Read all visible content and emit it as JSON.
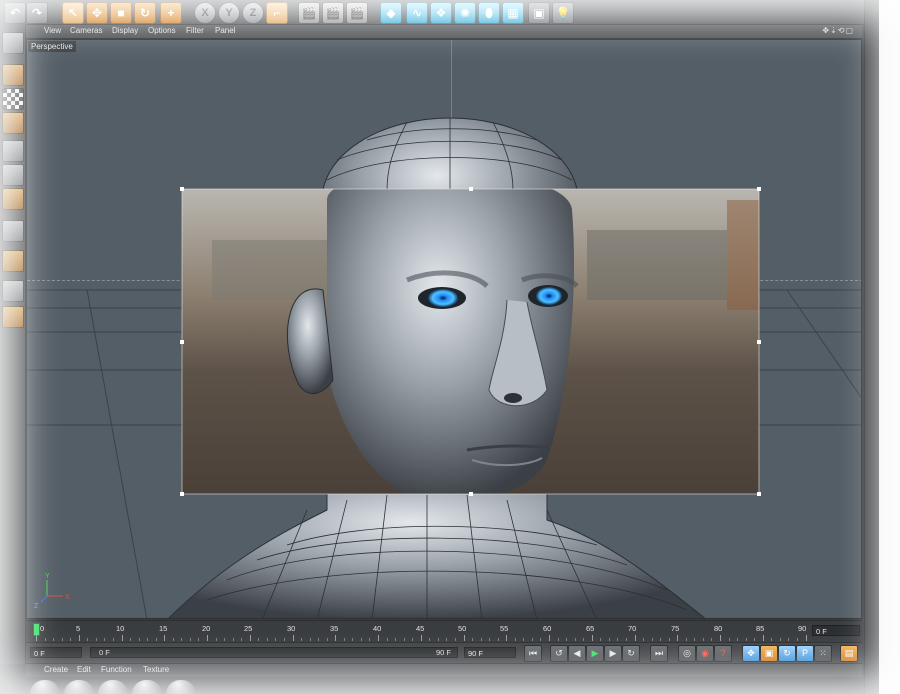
{
  "viewport": {
    "menu": [
      "View",
      "Cameras",
      "Display",
      "Options",
      "Filter",
      "Panel"
    ],
    "label": "Perspective",
    "axis_labels": {
      "y": "Y",
      "x": "X",
      "z": "Z"
    }
  },
  "toolbar": {
    "axis_buttons": [
      "X",
      "Y",
      "Z"
    ]
  },
  "timeline": {
    "ticks": [
      "0",
      "5",
      "10",
      "15",
      "20",
      "25",
      "30",
      "35",
      "40",
      "45",
      "50",
      "55",
      "60",
      "65",
      "70",
      "75",
      "80",
      "85",
      "90"
    ],
    "current_frame": "0 F",
    "start_field": "0 F",
    "scrub_start": "0 F",
    "scrub_end": "90 F",
    "end_field": "90 F"
  },
  "transport": {
    "keyframe_label": "P"
  },
  "material_manager": {
    "menu": [
      "Create",
      "Edit",
      "Function",
      "Texture"
    ]
  },
  "colors": {
    "viewport_bg": "#545e66",
    "accent_orange": "#cf7a1f",
    "eye_blue": "#2fa4ff",
    "play_green": "#3fe06a"
  }
}
